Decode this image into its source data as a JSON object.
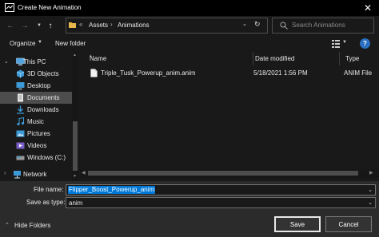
{
  "window": {
    "title": "Create New Animation",
    "close_icon": "close-icon"
  },
  "navigation": {
    "back_icon": "arrow-left-icon",
    "forward_icon": "arrow-right-icon",
    "recent_icon": "chevron-down-icon",
    "up_icon": "arrow-up-icon",
    "breadcrumb_prefix": "«",
    "breadcrumb": [
      "Assets",
      "Animations"
    ],
    "search_placeholder": "Search Animations"
  },
  "toolbar": {
    "organize_label": "Organize",
    "new_folder_label": "New folder",
    "view_icon": "view-options-icon",
    "help_icon": "help-icon",
    "help_glyph": "?"
  },
  "sidebar": {
    "items": [
      {
        "label": "This PC",
        "icon": "computer-icon",
        "expanded": true
      },
      {
        "label": "3D Objects",
        "icon": "cube-icon"
      },
      {
        "label": "Desktop",
        "icon": "desktop-icon"
      },
      {
        "label": "Documents",
        "icon": "document-folder-icon",
        "selected": true
      },
      {
        "label": "Downloads",
        "icon": "download-icon"
      },
      {
        "label": "Music",
        "icon": "music-icon"
      },
      {
        "label": "Pictures",
        "icon": "picture-icon"
      },
      {
        "label": "Videos",
        "icon": "video-icon"
      },
      {
        "label": "Windows (C:)",
        "icon": "drive-icon"
      },
      {
        "label": "Network",
        "icon": "network-icon"
      }
    ]
  },
  "file_list": {
    "columns": [
      "Name",
      "Date modified",
      "Type"
    ],
    "rows": [
      {
        "name": "Triple_Tusk_Powerup_anim.anim",
        "date": "5/18/2021 1:56 PM",
        "type": "ANIM File"
      }
    ]
  },
  "form": {
    "file_name_label": "File name:",
    "file_name_value": "Flipper_Boost_Powerup_anim",
    "save_as_type_label": "Save as type:",
    "save_as_type_value": "anim"
  },
  "footer": {
    "hide_folders_label": "Hide Folders",
    "save_label": "Save",
    "cancel_label": "Cancel"
  },
  "colors": {
    "background": "#191919",
    "panel": "#2b2b2b",
    "selection": "#0078d7",
    "sidebar_selected": "#4d4d4d"
  }
}
